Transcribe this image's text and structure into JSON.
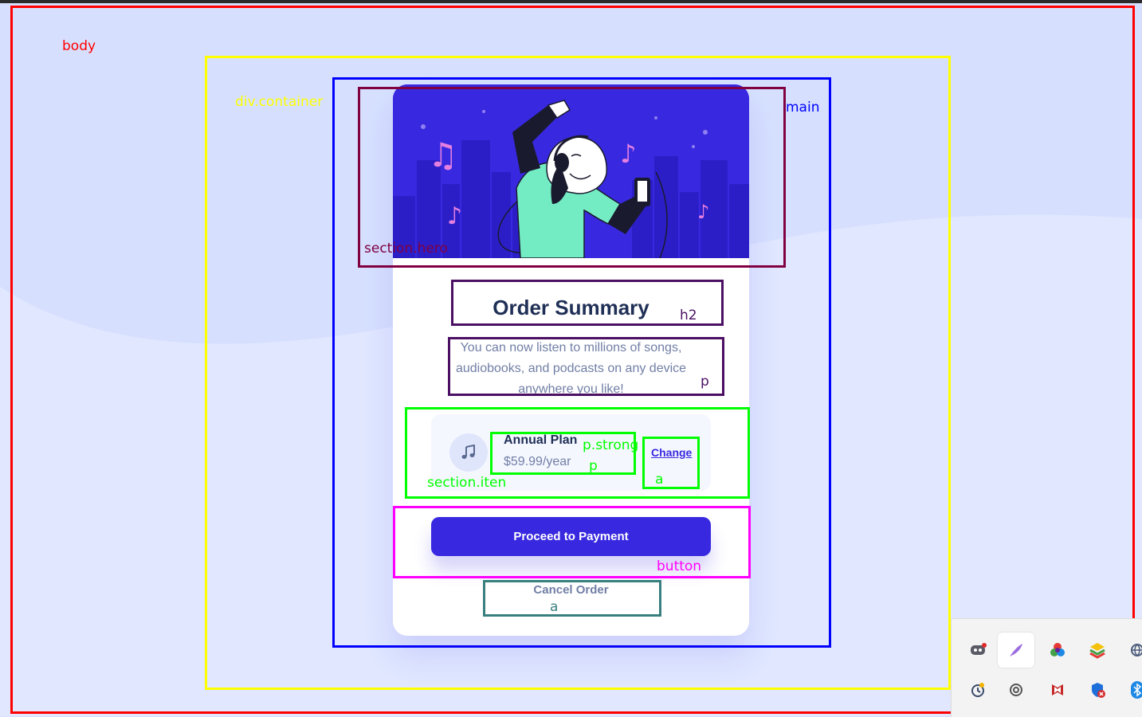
{
  "debug_labels": {
    "body": "body",
    "container": "div.container",
    "main": "main",
    "hero": "section.hero",
    "h2": "h2",
    "p": "p",
    "item": "section.iten",
    "p_strong": "p.strong",
    "p_price": "p",
    "a_change": "a",
    "button": "button",
    "a_cancel": "a"
  },
  "colors": {
    "outline_body": "#ff0000",
    "outline_container": "#ffff00",
    "outline_main": "#0000ff",
    "outline_hero": "#800040",
    "outline_text": "#4b0f63",
    "outline_item": "#00ff00",
    "outline_button": "#ff00ff",
    "outline_cancel": "#3a7f80",
    "primary": "#3829e0",
    "heading": "#1f2f56",
    "muted": "#717fa6"
  },
  "order": {
    "title": "Order Summary",
    "description": "You can now listen to millions of songs, audiobooks, and podcasts on any device anywhere you like!",
    "plan_icon": "music-note-icon",
    "plan_name": "Annual Plan",
    "plan_price": "$59.99/year",
    "change_label": "Change",
    "pay_label": "Proceed to Payment",
    "cancel_label": "Cancel Order"
  },
  "tray_icons": [
    "discord-icon",
    "feather-icon",
    "color-wheel-icon",
    "bluestacks-icon",
    "globe-icon",
    "clock-icon",
    "sync-icon",
    "mcafee-icon",
    "defender-icon",
    "bluetooth-icon"
  ]
}
